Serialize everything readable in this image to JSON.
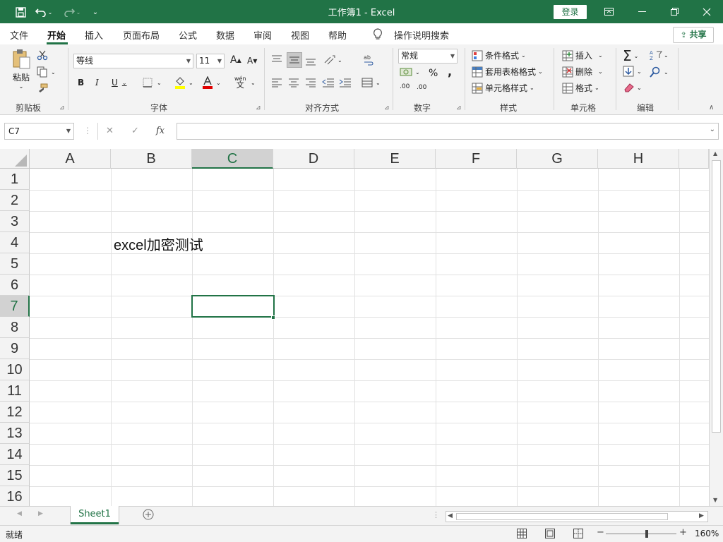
{
  "window": {
    "title": "工作簿1  -  Excel",
    "login": "登录",
    "icons": {
      "save": "save-icon",
      "undo": "undo-icon",
      "redo": "redo-icon",
      "customize": "customize-qa-icon"
    }
  },
  "menu": {
    "tabs": [
      "文件",
      "开始",
      "插入",
      "页面布局",
      "公式",
      "数据",
      "审阅",
      "视图",
      "帮助"
    ],
    "active": "开始",
    "tell_me": "操作说明搜索",
    "share": "共享"
  },
  "ribbon": {
    "clipboard": {
      "label": "剪贴板",
      "paste": "粘贴"
    },
    "font": {
      "label": "字体",
      "font_name": "等线",
      "font_size": "11",
      "bold": "B",
      "italic": "I",
      "underline": "U",
      "grow": "A",
      "shrink": "A",
      "phonetic_top": "wén",
      "phonetic_bottom": "文"
    },
    "alignment": {
      "label": "对齐方式"
    },
    "number": {
      "label": "数字",
      "format": "常规",
      "percent": "%",
      "comma": ",",
      "inc_decimal": ".00",
      "dec_decimal": ".00"
    },
    "styles": {
      "label": "样式",
      "conditional": "条件格式",
      "table": "套用表格格式",
      "cell_styles": "单元格样式"
    },
    "cells": {
      "label": "单元格",
      "insert": "插入",
      "delete": "删除",
      "format": "格式"
    },
    "editing": {
      "label": "编辑",
      "sum": "Σ"
    }
  },
  "formula_bar": {
    "name_box": "C7",
    "cancel": "✕",
    "enter": "✓",
    "fx": "fx",
    "content": ""
  },
  "grid": {
    "columns": [
      "A",
      "B",
      "C",
      "D",
      "E",
      "F",
      "G",
      "H"
    ],
    "rows": [
      "1",
      "2",
      "3",
      "4",
      "5",
      "6",
      "7",
      "8",
      "9",
      "10",
      "11",
      "12",
      "13",
      "14",
      "15",
      "16"
    ],
    "selected_column": "C",
    "selected_row": "7",
    "cells": {
      "B4": "excel加密测试"
    }
  },
  "sheets": {
    "tabs": [
      "Sheet1"
    ],
    "active": "Sheet1"
  },
  "status": {
    "mode": "就绪",
    "zoom": "160%",
    "minus": "−",
    "plus": "+"
  },
  "colors": {
    "accent": "#217346"
  }
}
